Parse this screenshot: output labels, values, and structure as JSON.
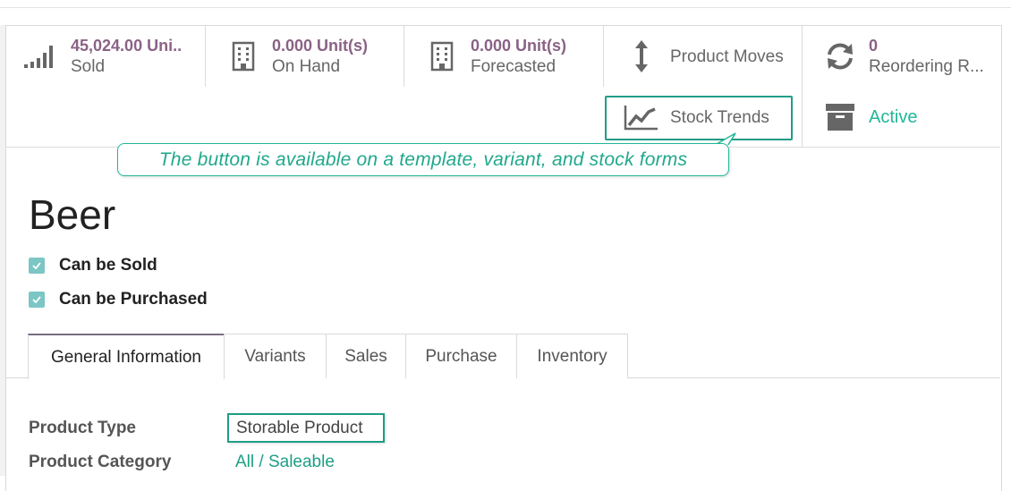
{
  "stat_buttons": {
    "sold": {
      "value": "45,024.00 Uni..",
      "label": "Sold",
      "icon": "signal-bars-icon"
    },
    "on_hand": {
      "value": "0.000 Unit(s)",
      "label": "On Hand",
      "icon": "building-icon"
    },
    "forecasted": {
      "value": "0.000 Unit(s)",
      "label": "Forecasted",
      "icon": "building-icon"
    },
    "product_moves": {
      "label": "Product Moves",
      "icon": "vertical-arrows-icon"
    },
    "reordering": {
      "value": "0",
      "label": "Reordering R...",
      "icon": "refresh-icon"
    },
    "stock_trends": {
      "label": "Stock Trends",
      "icon": "line-chart-icon"
    },
    "active": {
      "label": "Active",
      "icon": "archive-icon"
    }
  },
  "callout": {
    "text": "The button is available on a template, variant, and stock forms"
  },
  "product": {
    "name": "Beer",
    "can_be_sold_label": "Can be Sold",
    "can_be_purchased_label": "Can be Purchased"
  },
  "tabs": [
    {
      "label": "General Information"
    },
    {
      "label": "Variants"
    },
    {
      "label": "Sales"
    },
    {
      "label": "Purchase"
    },
    {
      "label": "Inventory"
    }
  ],
  "fields": {
    "product_type_label": "Product Type",
    "product_type_value": "Storable Product",
    "product_category_label": "Product Category",
    "product_category_value": "All / Saleable"
  },
  "colors": {
    "stat_value": "#8a6285",
    "accent_green": "#21b799",
    "highlight_border": "#1f9d86",
    "checkbox": "#7cc6c5"
  }
}
